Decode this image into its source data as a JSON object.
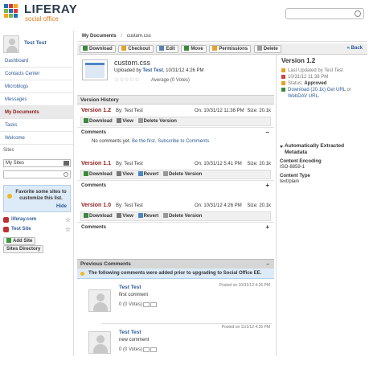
{
  "header": {
    "brand": "LIFERAY",
    "brand_sub": "social office"
  },
  "user": {
    "name": "Test Test"
  },
  "nav": [
    "Dashboard",
    "Contacts Center",
    "Microblogs",
    "Messages",
    "My Documents",
    "Tasks",
    "Welcome"
  ],
  "nav_active": "My Documents",
  "sites": {
    "heading": "Sites",
    "dropdown": "My Sites",
    "fav_msg": "Favorite some sites to customize this list.",
    "hide": "Hide",
    "list": [
      "liferay.com",
      "Test Site"
    ],
    "add_site": "Add Site",
    "directory": "Sites Directory"
  },
  "breadcrumb": {
    "root": "My Documents",
    "sep": "/",
    "current": "custom.css"
  },
  "toolbar": [
    "Download",
    "Checkout",
    "Edit",
    "Move",
    "Permissions",
    "Delete"
  ],
  "back": "« Back",
  "document": {
    "name": "custom.css",
    "uploaded_prefix": "Uploaded by",
    "uploaded_by": "Test Test",
    "uploaded_date": ", 10/31/12 4:26 PM",
    "stars": "☆☆☆☆☆",
    "average": "Average (0 Votes)"
  },
  "version_history_title": "Version History",
  "versions": [
    {
      "num": "Version 1.2",
      "by": "By: Test Test",
      "on": "On: 10/31/12 11:38 PM",
      "size": "Size: 20.1k",
      "actions": [
        "Download",
        "View",
        "Delete Version"
      ],
      "comments_label": "Comments",
      "toggle": "–",
      "no_comments": "No comments yet.",
      "be_first": "Be the first.",
      "subscribe": "Subscribe to Comments"
    },
    {
      "num": "Version 1.1",
      "by": "By: Test Test",
      "on": "On: 10/31/12 5:41 PM",
      "size": "Size: 20.1k",
      "actions": [
        "Download",
        "View",
        "Revert",
        "Delete Version"
      ],
      "comments_label": "Comments",
      "toggle": "+"
    },
    {
      "num": "Version 1.0",
      "by": "By: Test Test",
      "on": "On: 10/31/12 4:26 PM",
      "size": "Size: 20.1k",
      "actions": [
        "Download",
        "View",
        "Revert",
        "Delete Version"
      ],
      "comments_label": "Comments",
      "toggle": "+"
    }
  ],
  "previous_comments": {
    "title": "Previous Comments",
    "toggle": "–",
    "notice": "The following comments were added prior to upgrading to Social Office EE.",
    "items": [
      {
        "name": "Test Test",
        "date": "Posted on 10/31/12 4:26 PM",
        "text": "first comment",
        "votes": "0 (0 Votes)"
      },
      {
        "name": "Test Test",
        "date": "Posted on 11/1/12 4:35 PM",
        "text": "new comment",
        "votes": "0 (0 Votes)"
      }
    ]
  },
  "side": {
    "version": "Version 1.2",
    "last_updated": "Last Updated by Test Test",
    "date": "10/31/12 11:38 PM",
    "status_label": "Status:",
    "status_value": "Approved",
    "download": "Download (20.1k)",
    "get_url": "Get URL",
    "or": "or",
    "webdav": "WebDAV URL.",
    "meta_title": "Automatically Extracted Metadata",
    "meta": [
      {
        "k": "Content Encoding",
        "v": "ISO-8859-1"
      },
      {
        "k": "Content Type",
        "v": "text/plain"
      }
    ]
  },
  "colors": {
    "accent_link": "#2c5a96",
    "version_red": "#8a1a1a",
    "notice_bg": "#ddebf8"
  }
}
